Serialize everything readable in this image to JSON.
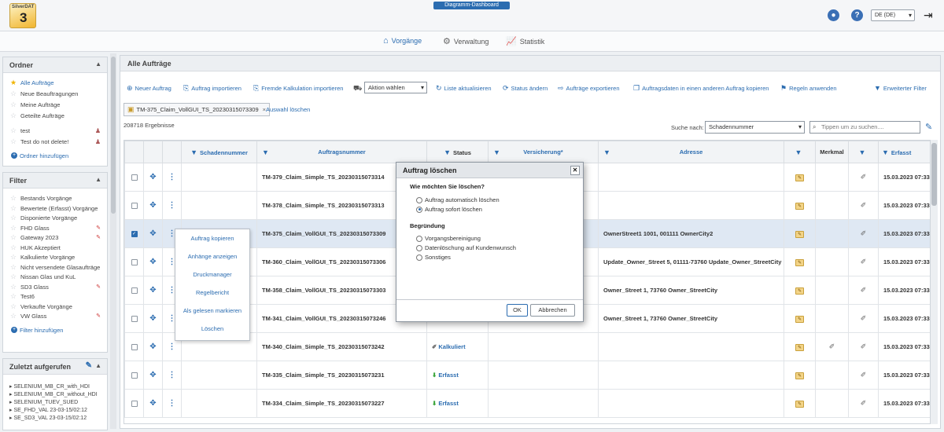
{
  "header": {
    "logo_text": "SilverDAT",
    "logo_number": "3",
    "app_title": "Diagramm-Dashboard",
    "language": "DE (DE)"
  },
  "nav": {
    "items": [
      {
        "label": "Vorgänge",
        "icon": "home-icon",
        "active": true
      },
      {
        "label": "Verwaltung",
        "icon": "gear-icon",
        "active": false
      },
      {
        "label": "Statistik",
        "icon": "chart-icon",
        "active": false
      }
    ]
  },
  "sidebar": {
    "ordner": {
      "title": "Ordner",
      "items": [
        "Alle Aufträge",
        "Neue Beauftragungen",
        "Meine Aufträge",
        "Geteilte Aufträge",
        "test",
        "Test do not delete!"
      ],
      "add_label": "Ordner hinzufügen"
    },
    "filter": {
      "title": "Filter",
      "items": [
        "Bestands Vorgänge",
        "Bewertete (Erfasst) Vorgänge",
        "Disponierte Vorgänge",
        "FHD Glass",
        "Gateway 2023",
        "HUK Akzeptiert",
        "Kalkulierte Vorgänge",
        "Nicht versendete Glasaufträge",
        "Nissan Glas und KuL",
        "SD3 Glass",
        "Test6",
        "Verkaufte Vorgänge",
        "VW Glass"
      ],
      "add_label": "Filter hinzufügen"
    },
    "recent": {
      "title": "Zuletzt aufgerufen",
      "items": [
        "SELENIUM_MB_CR_with_HDI",
        "SELENIUM_MB_CR_without_HDI",
        "SELENIUM_TUEV_SUED",
        "SE_FHD_VAL 23-03-15/02:12",
        "SE_SD3_VAL 23-03-15/02:12"
      ]
    }
  },
  "main": {
    "title": "Alle Aufträge",
    "toolbar": {
      "new_order": "Neuer Auftrag",
      "import_order": "Auftrag importieren",
      "foreign_calc": "Fremde Kalkulation importieren",
      "action_select": "Aktion wählen",
      "refresh": "Liste aktualisieren",
      "change_status": "Status ändern",
      "export": "Aufträge exportieren",
      "copy_data": "Auftragsdaten in einen anderen Auftrag kopieren",
      "apply_rules": "Regeln anwenden",
      "extended_filter": "Erweiterter Filter"
    },
    "selection_chip": "TM-375_Claim_VollGUI_TS_20230315073309",
    "clear_selection": "Auswahl löschen",
    "results": "208718 Ergebnisse",
    "search_label": "Suche nach:",
    "search_field": "Schadennummer",
    "search_placeholder": "Tippen um zu suchen....",
    "columns": [
      "Schadennummer",
      "Auftragsnummer",
      "Status",
      "Versicherung*",
      "Adresse",
      "Merkmal",
      "Erfasst"
    ],
    "rows": [
      {
        "auftrag": "TM-379_Claim_Simple_TS_20230315073314",
        "status": "",
        "adresse": "",
        "erfasst": "15.03.2023 07:33",
        "selected": false,
        "merkmal": false
      },
      {
        "auftrag": "TM-378_Claim_Simple_TS_20230315073313",
        "status": "",
        "adresse": "",
        "erfasst": "15.03.2023 07:33",
        "selected": false,
        "merkmal": false
      },
      {
        "auftrag": "TM-375_Claim_VollGUI_TS_20230315073309",
        "status": "",
        "adresse": "OwnerStreet1 1001, 001111 OwnerCity2",
        "erfasst": "15.03.2023 07:33",
        "selected": true,
        "merkmal": false
      },
      {
        "auftrag": "TM-360_Claim_VollGUI_TS_20230315073306",
        "status": "",
        "adresse": "Update_Owner_Street 5, 01111-73760 Update_Owner_StreetCity",
        "erfasst": "15.03.2023 07:33",
        "selected": false,
        "merkmal": false
      },
      {
        "auftrag": "TM-358_Claim_VollGUI_TS_20230315073303",
        "status": "",
        "adresse": "Owner_Street 1, 73760 Owner_StreetCity",
        "erfasst": "15.03.2023 07:33",
        "selected": false,
        "merkmal": false
      },
      {
        "auftrag": "TM-341_Claim_VollGUI_TS_20230315073246",
        "status": "",
        "adresse": "Owner_Street 1, 73760 Owner_StreetCity",
        "erfasst": "15.03.2023 07:33",
        "selected": false,
        "merkmal": false
      },
      {
        "auftrag": "TM-340_Claim_Simple_TS_20230315073242",
        "status": "Kalkuliert",
        "adresse": "",
        "erfasst": "15.03.2023 07:33",
        "selected": false,
        "merkmal": true
      },
      {
        "auftrag": "TM-335_Claim_Simple_TS_20230315073231",
        "status": "Erfasst",
        "adresse": "",
        "erfasst": "15.03.2023 07:33",
        "selected": false,
        "merkmal": false
      },
      {
        "auftrag": "TM-334_Claim_Simple_TS_20230315073227",
        "status": "Erfasst",
        "adresse": "",
        "erfasst": "15.03.2023 07:33",
        "selected": false,
        "merkmal": false
      }
    ]
  },
  "context_menu": {
    "items": [
      "Auftrag kopieren",
      "Anhänge anzeigen",
      "Druckmanager",
      "Regelbericht",
      "Als gelesen markieren",
      "Löschen"
    ]
  },
  "modal": {
    "title": "Auftrag löschen",
    "question": "Wie möchten Sie löschen?",
    "delete_options": [
      "Auftrag automatisch löschen",
      "Auftrag sofort löschen"
    ],
    "delete_selected": 1,
    "reason_label": "Begründung",
    "reasons": [
      "Vorgangsbereinigung",
      "Datenlöschung auf Kundenwunsch",
      "Sonstiges"
    ],
    "ok_label": "OK",
    "cancel_label": "Abbrechen"
  },
  "colors": {
    "accent": "#2b6cb0",
    "selected_row": "#dfe8f3",
    "star_active": "#f0b400"
  }
}
